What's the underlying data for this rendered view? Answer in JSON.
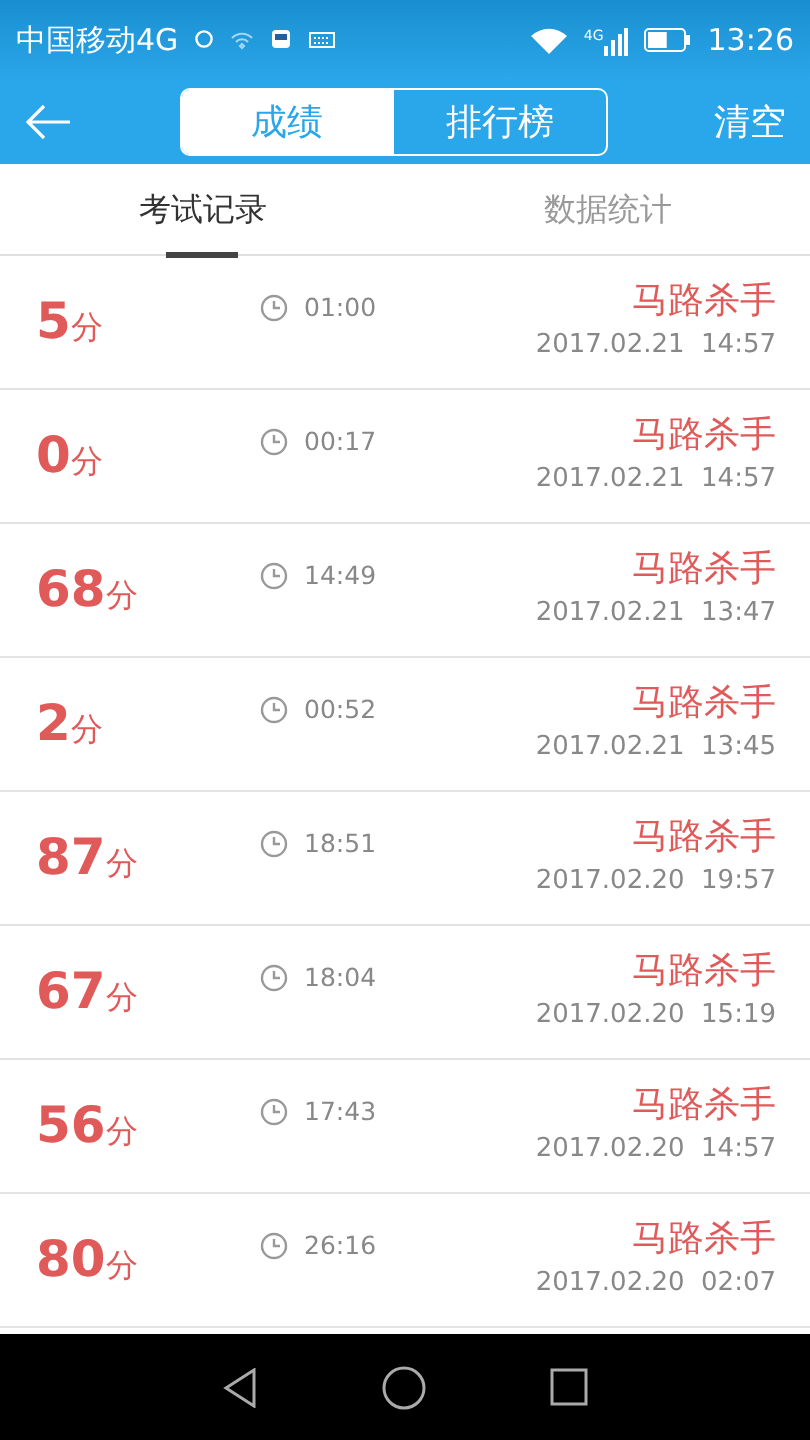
{
  "status_bar": {
    "carrier": "中国移动4G",
    "network": "4G",
    "time": "13:26"
  },
  "header": {
    "segments": [
      {
        "label": "成绩",
        "selected": true
      },
      {
        "label": "排行榜",
        "selected": false
      }
    ],
    "action": "清空"
  },
  "tabs": [
    {
      "label": "考试记录",
      "selected": true
    },
    {
      "label": "数据统计",
      "selected": false
    }
  ],
  "records": [
    {
      "score": "5",
      "unit": "分",
      "duration": "01:00",
      "title": "马路杀手",
      "date": "2017.02.21  14:57"
    },
    {
      "score": "0",
      "unit": "分",
      "duration": "00:17",
      "title": "马路杀手",
      "date": "2017.02.21  14:57"
    },
    {
      "score": "68",
      "unit": "分",
      "duration": "14:49",
      "title": "马路杀手",
      "date": "2017.02.21  13:47"
    },
    {
      "score": "2",
      "unit": "分",
      "duration": "00:52",
      "title": "马路杀手",
      "date": "2017.02.21  13:45"
    },
    {
      "score": "87",
      "unit": "分",
      "duration": "18:51",
      "title": "马路杀手",
      "date": "2017.02.20  19:57"
    },
    {
      "score": "67",
      "unit": "分",
      "duration": "18:04",
      "title": "马路杀手",
      "date": "2017.02.20  15:19"
    },
    {
      "score": "56",
      "unit": "分",
      "duration": "17:43",
      "title": "马路杀手",
      "date": "2017.02.20  14:57"
    },
    {
      "score": "80",
      "unit": "分",
      "duration": "26:16",
      "title": "马路杀手",
      "date": "2017.02.20  02:07"
    }
  ]
}
